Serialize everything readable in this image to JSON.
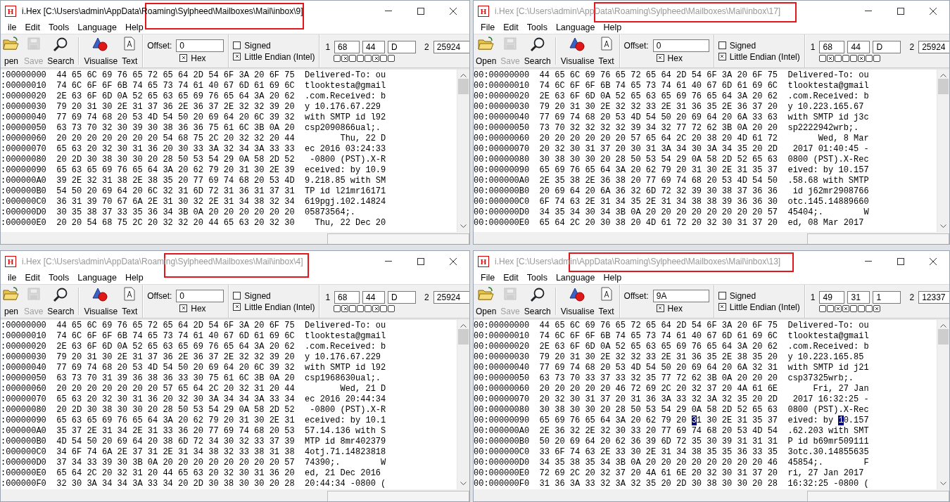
{
  "windows": [
    {
      "icon_text": "H",
      "title": "i.Hex [C:\\Users\\admin\\AppData\\Roaming\\Sylpheed\\Mailboxes\\Mail\\inbox\\9]",
      "active": true,
      "menu": [
        "ile",
        "Edit",
        "Tools",
        "Language",
        "Help"
      ],
      "toolbar": [
        {
          "kind": "open",
          "label": "pen",
          "disabled": false
        },
        {
          "kind": "save",
          "label": "Save",
          "disabled": true
        },
        {
          "kind": "search",
          "label": "Search",
          "disabled": false
        },
        {
          "kind": "visualise",
          "label": "Visualise",
          "disabled": false
        },
        {
          "kind": "text",
          "label": "Text",
          "disabled": false
        }
      ],
      "offset": {
        "label": "Offset:",
        "value": "0"
      },
      "hex_checkbox": {
        "label": "Hex",
        "checked": true
      },
      "signed": {
        "label": "Signed",
        "checked": false
      },
      "little_endian": {
        "label": "Little Endian (Intel)",
        "checked": true
      },
      "values": {
        "label_1": "1",
        "fields_1": [
          "68",
          "44",
          "D"
        ],
        "label_2": "2",
        "field_2": "25924"
      },
      "bits": [
        {
          "checked": false
        },
        {
          "checked": true
        },
        {
          "checked": false
        },
        {
          "checked": false
        },
        {
          "checked": false
        },
        {
          "checked": true
        },
        {
          "checked": false
        },
        {
          "checked": false
        }
      ],
      "rows": [
        {
          "address": ":00000000",
          "hex": "44 65 6C 69 76 65 72 65 64 2D 54 6F 3A 20 6F 75",
          "ascii": "Delivered-To: ou"
        },
        {
          "address": ":00000010",
          "hex": "74 6C 6F 6F 6B 74 65 73 74 61 40 67 6D 61 69 6C",
          "ascii": "tlooktesta@gmail"
        },
        {
          "address": ":00000020",
          "hex": "2E 63 6F 6D 0A 52 65 63 65 69 76 65 64 3A 20 62",
          "ascii": ".com.Received: b"
        },
        {
          "address": ":00000030",
          "hex": "79 20 31 30 2E 31 37 36 2E 36 37 2E 32 32 39 20",
          "ascii": "y 10.176.67.229 "
        },
        {
          "address": ":00000040",
          "hex": "77 69 74 68 20 53 4D 54 50 20 69 64 20 6C 39 32",
          "ascii": "with SMTP id l92"
        },
        {
          "address": ":00000050",
          "hex": "63 73 70 32 30 39 30 38 36 36 75 61 6C 3B 0A 20",
          "ascii": "csp2090866ual;. "
        },
        {
          "address": ":00000060",
          "hex": "20 20 20 20 20 20 20 54 68 75 2C 20 32 32 20 44",
          "ascii": "       Thu, 22 D"
        },
        {
          "address": ":00000070",
          "hex": "65 63 20 32 30 31 36 20 30 33 3A 32 34 3A 33 33",
          "ascii": "ec 2016 03:24:33"
        },
        {
          "address": ":00000080",
          "hex": "20 2D 30 38 30 30 20 28 50 53 54 29 0A 58 2D 52",
          "ascii": " -0800 (PST).X-R"
        },
        {
          "address": ":00000090",
          "hex": "65 63 65 69 76 65 64 3A 20 62 79 20 31 30 2E 39",
          "ascii": "eceived: by 10.9"
        },
        {
          "address": ":000000A0",
          "hex": "39 2E 32 31 38 2E 38 35 20 77 69 74 68 20 53 4D",
          "ascii": "9.218.85 with SM"
        },
        {
          "address": ":000000B0",
          "hex": "54 50 20 69 64 20 6C 32 31 6D 72 31 36 31 37 31",
          "ascii": "TP id l21mr16171"
        },
        {
          "address": ":000000C0",
          "hex": "36 31 39 70 67 6A 2E 31 30 32 2E 31 34 38 32 34",
          "ascii": "619pgj.102.14824"
        },
        {
          "address": ":000000D0",
          "hex": "30 35 38 37 33 35 36 34 3B 0A 20 20 20 20 20 20",
          "ascii": "05873564;.      "
        },
        {
          "address": ":000000E0",
          "hex": "20 20 54 68 75 2C 20 32 32 20 44 65 63 20 32 30",
          "ascii": "  Thu, 22 Dec 20"
        }
      ]
    },
    {
      "icon_text": "H",
      "title": "i.Hex [C:\\Users\\admin\\AppData\\Roaming\\Sylpheed\\Mailboxes\\Mail\\inbox\\17]",
      "active": false,
      "menu": [
        "File",
        "Edit",
        "Tools",
        "Language",
        "Help"
      ],
      "toolbar": [
        {
          "kind": "open",
          "label": "Open",
          "disabled": false
        },
        {
          "kind": "save",
          "label": "Save",
          "disabled": true
        },
        {
          "kind": "search",
          "label": "Search",
          "disabled": false
        },
        {
          "kind": "visualise",
          "label": "Visualise",
          "disabled": false
        },
        {
          "kind": "text",
          "label": "Text",
          "disabled": false
        }
      ],
      "offset": {
        "label": "Offset:",
        "value": "0"
      },
      "hex_checkbox": {
        "label": "Hex",
        "checked": true
      },
      "signed": {
        "label": "Signed",
        "checked": false
      },
      "little_endian": {
        "label": "Little Endian (Intel)",
        "checked": true
      },
      "values": {
        "label_1": "1",
        "fields_1": [
          "68",
          "44",
          "D"
        ],
        "label_2": "2",
        "field_2": "25924"
      },
      "bits": [
        {
          "checked": false
        },
        {
          "checked": true
        },
        {
          "checked": false
        },
        {
          "checked": false
        },
        {
          "checked": false
        },
        {
          "checked": true
        },
        {
          "checked": false
        },
        {
          "checked": false
        }
      ],
      "rows": [
        {
          "address": "00:00000000",
          "hex": "44 65 6C 69 76 65 72 65 64 2D 54 6F 3A 20 6F 75",
          "ascii": "Delivered-To: ou"
        },
        {
          "address": "00:00000010",
          "hex": "74 6C 6F 6F 6B 74 65 73 74 61 40 67 6D 61 69 6C",
          "ascii": "tlooktesta@gmail"
        },
        {
          "address": "00:00000020",
          "hex": "2E 63 6F 6D 0A 52 65 63 65 69 76 65 64 3A 20 62",
          "ascii": ".com.Received: b"
        },
        {
          "address": "00:00000030",
          "hex": "79 20 31 30 2E 32 32 33 2E 31 36 35 2E 36 37 20",
          "ascii": "y 10.223.165.67 "
        },
        {
          "address": "00:00000040",
          "hex": "77 69 74 68 20 53 4D 54 50 20 69 64 20 6A 33 63",
          "ascii": "with SMTP id j3c"
        },
        {
          "address": "00:00000050",
          "hex": "73 70 32 32 32 32 39 34 32 77 72 62 3B 0A 20 20",
          "ascii": "sp2222942wrb;.  "
        },
        {
          "address": "00:00000060",
          "hex": "20 20 20 20 20 20 57 65 64 2C 20 38 20 4D 61 72",
          "ascii": "      Wed, 8 Mar"
        },
        {
          "address": "00:00000070",
          "hex": "20 32 30 31 37 20 30 31 3A 34 30 3A 34 35 20 2D",
          "ascii": " 2017 01:40:45 -"
        },
        {
          "address": "00:00000080",
          "hex": "30 38 30 30 20 28 50 53 54 29 0A 58 2D 52 65 63",
          "ascii": "0800 (PST).X-Rec"
        },
        {
          "address": "00:00000090",
          "hex": "65 69 76 65 64 3A 20 62 79 20 31 30 2E 31 35 37",
          "ascii": "eived: by 10.157"
        },
        {
          "address": "00:000000A0",
          "hex": "2E 35 38 2E 36 38 20 77 69 74 68 20 53 4D 54 50",
          "ascii": ".58.68 with SMTP"
        },
        {
          "address": "00:000000B0",
          "hex": "20 69 64 20 6A 36 32 6D 72 32 39 30 38 37 36 36",
          "ascii": " id j62mr2908766"
        },
        {
          "address": "00:000000C0",
          "hex": "6F 74 63 2E 31 34 35 2E 31 34 38 38 39 36 36 30",
          "ascii": "otc.145.14889660"
        },
        {
          "address": "00:000000D0",
          "hex": "34 35 34 30 34 3B 0A 20 20 20 20 20 20 20 20 57",
          "ascii": "45404;.        W"
        },
        {
          "address": "00:000000E0",
          "hex": "65 64 2C 20 30 38 20 4D 61 72 20 32 30 31 37 20",
          "ascii": "ed, 08 Mar 2017 "
        }
      ]
    },
    {
      "icon_text": "H",
      "title": "i.Hex [C:\\Users\\admin\\AppData\\Roaming\\Sylpheed\\Mailboxes\\Mail\\inbox\\4]",
      "active": false,
      "menu": [
        "ile",
        "Edit",
        "Tools",
        "Language",
        "Help"
      ],
      "toolbar": [
        {
          "kind": "open",
          "label": "pen",
          "disabled": false
        },
        {
          "kind": "save",
          "label": "Save",
          "disabled": true
        },
        {
          "kind": "search",
          "label": "Search",
          "disabled": false
        },
        {
          "kind": "visualise",
          "label": "Visualise",
          "disabled": false
        },
        {
          "kind": "text",
          "label": "Text",
          "disabled": false
        }
      ],
      "offset": {
        "label": "Offset:",
        "value": "0"
      },
      "hex_checkbox": {
        "label": "Hex",
        "checked": true
      },
      "signed": {
        "label": "Signed",
        "checked": false
      },
      "little_endian": {
        "label": "Little Endian (Intel)",
        "checked": true
      },
      "values": {
        "label_1": "1",
        "fields_1": [
          "68",
          "44",
          "D"
        ],
        "label_2": "2",
        "field_2": "25924"
      },
      "bits": [
        {
          "checked": false
        },
        {
          "checked": true
        },
        {
          "checked": false
        },
        {
          "checked": false
        },
        {
          "checked": false
        },
        {
          "checked": true
        },
        {
          "checked": false
        },
        {
          "checked": false
        }
      ],
      "rows": [
        {
          "address": ":00000000",
          "hex": "44 65 6C 69 76 65 72 65 64 2D 54 6F 3A 20 6F 75",
          "ascii": "Delivered-To: ou"
        },
        {
          "address": ":00000010",
          "hex": "74 6C 6F 6F 6B 74 65 73 74 61 40 67 6D 61 69 6C",
          "ascii": "tlooktesta@gmail"
        },
        {
          "address": ":00000020",
          "hex": "2E 63 6F 6D 0A 52 65 63 65 69 76 65 64 3A 20 62",
          "ascii": ".com.Received: b"
        },
        {
          "address": ":00000030",
          "hex": "79 20 31 30 2E 31 37 36 2E 36 37 2E 32 32 39 20",
          "ascii": "y 10.176.67.229 "
        },
        {
          "address": ":00000040",
          "hex": "77 69 74 68 20 53 4D 54 50 20 69 64 20 6C 39 32",
          "ascii": "with SMTP id l92"
        },
        {
          "address": ":00000050",
          "hex": "63 73 70 31 39 36 38 36 33 30 75 61 6C 3B 0A 20",
          "ascii": "csp1968630ual;. "
        },
        {
          "address": ":00000060",
          "hex": "20 20 20 20 20 20 20 57 65 64 2C 20 32 31 20 44",
          "ascii": "       Wed, 21 D"
        },
        {
          "address": ":00000070",
          "hex": "65 63 20 32 30 31 36 20 32 30 3A 34 34 3A 33 34",
          "ascii": "ec 2016 20:44:34"
        },
        {
          "address": ":00000080",
          "hex": "20 2D 30 38 30 30 20 28 50 53 54 29 0A 58 2D 52",
          "ascii": " -0800 (PST).X-R"
        },
        {
          "address": ":00000090",
          "hex": "65 63 65 69 76 65 64 3A 20 62 79 20 31 30 2E 31",
          "ascii": "eceived: by 10.1"
        },
        {
          "address": ":000000A0",
          "hex": "35 37 2E 31 34 2E 31 33 36 20 77 69 74 68 20 53",
          "ascii": "57.14.136 with S"
        },
        {
          "address": ":000000B0",
          "hex": "4D 54 50 20 69 64 20 38 6D 72 34 30 32 33 37 39",
          "ascii": "MTP id 8mr402379"
        },
        {
          "address": ":000000C0",
          "hex": "34 6F 74 6A 2E 37 31 2E 31 34 38 32 33 38 31 38",
          "ascii": "4otj.71.14823818"
        },
        {
          "address": ":000000D0",
          "hex": "37 34 33 39 30 3B 0A 20 20 20 20 20 20 20 20 57",
          "ascii": "74390;.        W"
        },
        {
          "address": ":000000E0",
          "hex": "65 64 2C 20 32 31 20 44 65 63 20 32 30 31 36 20",
          "ascii": "ed, 21 Dec 2016 "
        },
        {
          "address": ":000000F0",
          "hex": "32 30 3A 34 34 3A 33 34 20 2D 30 38 30 30 20 28",
          "ascii": "20:44:34 -0800 ("
        }
      ]
    },
    {
      "icon_text": "H",
      "title": "i.Hex [C:\\Users\\admin\\AppData\\Roaming\\Sylpheed\\Mailboxes\\Mail\\inbox\\13]",
      "active": false,
      "menu": [
        "File",
        "Edit",
        "Tools",
        "Language",
        "Help"
      ],
      "toolbar": [
        {
          "kind": "open",
          "label": "Open",
          "disabled": false
        },
        {
          "kind": "save",
          "label": "Save",
          "disabled": true
        },
        {
          "kind": "search",
          "label": "Search",
          "disabled": false
        },
        {
          "kind": "visualise",
          "label": "Visualise",
          "disabled": false
        },
        {
          "kind": "text",
          "label": "Text",
          "disabled": false
        }
      ],
      "offset": {
        "label": "Offset:",
        "value": "9A"
      },
      "hex_checkbox": {
        "label": "Hex",
        "checked": true
      },
      "signed": {
        "label": "Signed",
        "checked": false
      },
      "little_endian": {
        "label": "Little Endian (Intel)",
        "checked": true
      },
      "values": {
        "label_1": "1",
        "fields_1": [
          "49",
          "31",
          "1"
        ],
        "label_2": "2",
        "field_2": "12337"
      },
      "bits": [
        {
          "checked": false
        },
        {
          "checked": false
        },
        {
          "checked": true
        },
        {
          "checked": true
        },
        {
          "checked": false
        },
        {
          "checked": false
        },
        {
          "checked": false
        },
        {
          "checked": true
        }
      ],
      "rows": [
        {
          "address": "00:00000000",
          "hex": "44 65 6C 69 76 65 72 65 64 2D 54 6F 3A 20 6F 75",
          "ascii": "Delivered-To: ou"
        },
        {
          "address": "00:00000010",
          "hex": "74 6C 6F 6F 6B 74 65 73 74 61 40 67 6D 61 69 6C",
          "ascii": "tlooktesta@gmail"
        },
        {
          "address": "00:00000020",
          "hex": "2E 63 6F 6D 0A 52 65 63 65 69 76 65 64 3A 20 62",
          "ascii": ".com.Received: b"
        },
        {
          "address": "00:00000030",
          "hex": "79 20 31 30 2E 32 32 33 2E 31 36 35 2E 38 35 20",
          "ascii": "y 10.223.165.85 "
        },
        {
          "address": "00:00000040",
          "hex": "77 69 74 68 20 53 4D 54 50 20 69 64 20 6A 32 31",
          "ascii": "with SMTP id j21"
        },
        {
          "address": "00:00000050",
          "hex": "63 73 70 33 37 33 32 35 77 72 62 3B 0A 20 20 20",
          "ascii": "csp37325wrb;.   "
        },
        {
          "address": "00:00000060",
          "hex": "20 20 20 20 20 46 72 69 2C 20 32 37 20 4A 61 6E",
          "ascii": "     Fri, 27 Jan"
        },
        {
          "address": "00:00000070",
          "hex": "20 32 30 31 37 20 31 36 3A 33 32 3A 32 35 20 2D",
          "ascii": " 2017 16:32:25 -"
        },
        {
          "address": "00:00000080",
          "hex": "30 38 30 30 20 28 50 53 54 29 0A 58 2D 52 65 63",
          "ascii": "0800 (PST).X-Rec"
        },
        {
          "address": "00:00000090",
          "hex": [
            {
              "text": "65 69 76 65 64 3A 20 62 79 20 ",
              "selected": false
            },
            {
              "text": "3",
              "selected": true
            },
            {
              "text": "1 30 2E 31 35 37",
              "selected": false
            }
          ],
          "ascii": [
            {
              "text": "eived: by ",
              "selected": false
            },
            {
              "text": "1",
              "selected": true
            },
            {
              "text": "0.157",
              "selected": false
            }
          ]
        },
        {
          "address": "00:000000A0",
          "hex": "2E 36 32 2E 32 30 33 20 77 69 74 68 20 53 4D 54",
          "ascii": ".62.203 with SMT"
        },
        {
          "address": "00:000000B0",
          "hex": "50 20 69 64 20 62 36 39 6D 72 35 30 39 31 31 31",
          "ascii": "P id b69mr509111"
        },
        {
          "address": "00:000000C0",
          "hex": "33 6F 74 63 2E 33 30 2E 31 34 38 35 35 36 33 35",
          "ascii": "3otc.30.14855635"
        },
        {
          "address": "00:000000D0",
          "hex": "34 35 38 35 34 3B 0A 20 20 20 20 20 20 20 20 46",
          "ascii": "45854;.        F"
        },
        {
          "address": "00:000000E0",
          "hex": "72 69 2C 20 32 37 20 4A 61 6E 20 32 30 31 37 20",
          "ascii": "ri, 27 Jan 2017 "
        },
        {
          "address": "00:000000F0",
          "hex": "31 36 3A 33 32 3A 32 35 20 2D 30 38 30 30 20 28",
          "ascii": "16:32:25 -0800 ("
        }
      ]
    }
  ]
}
